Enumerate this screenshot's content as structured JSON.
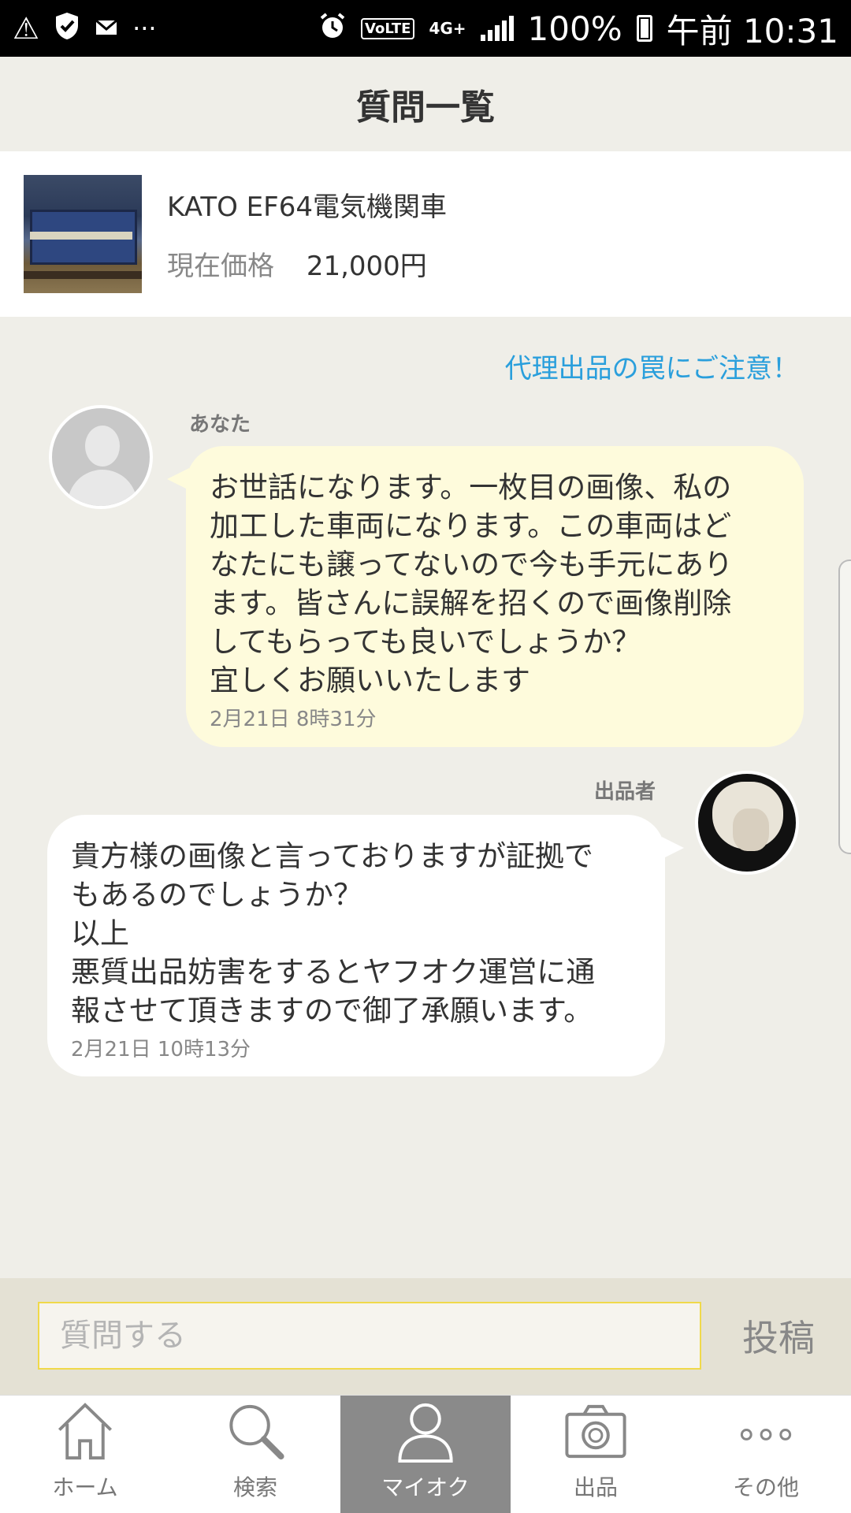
{
  "status_bar": {
    "battery": "100%",
    "time": "午前 10:31",
    "network": "4G+",
    "volte": "VoLTE"
  },
  "header": {
    "title": "質問一覧"
  },
  "item": {
    "name": "KATO EF64電気機関車",
    "price_label": "現在価格",
    "price": "21,000円"
  },
  "chat": {
    "warning_link": "代理出品の罠にご注意！",
    "messages": [
      {
        "sender": "あなた",
        "text": "お世話になります。一枚目の画像、私の\n加工した車両になります。この車両はど\nなたにも譲ってないので今も手元にあり\nます。皆さんに誤解を招くので画像削除\nしてもらっても良いでしょうか？\n宜しくお願いいたします",
        "time": "2月21日 8時31分"
      },
      {
        "sender": "出品者",
        "text": "貴方様の画像と言っておりますが証拠で\nもあるのでしょうか？\n以上\n悪質出品妨害をするとヤフオク運営に通\n報させて頂きますので御了承願います。",
        "time": "2月21日 10時13分"
      }
    ]
  },
  "composer": {
    "placeholder": "質問する",
    "value": "",
    "post_label": "投稿"
  },
  "nav": {
    "items": [
      {
        "label": "ホーム",
        "icon": "home-icon"
      },
      {
        "label": "検索",
        "icon": "search-icon"
      },
      {
        "label": "マイオク",
        "icon": "person-icon",
        "active": true
      },
      {
        "label": "出品",
        "icon": "camera-icon"
      },
      {
        "label": "その他",
        "icon": "more-icon"
      }
    ]
  },
  "colors": {
    "accent_link": "#2a9fdc",
    "own_bubble": "#fefbdc",
    "active_tab": "#8a8a8a",
    "input_border": "#f0d94a"
  }
}
